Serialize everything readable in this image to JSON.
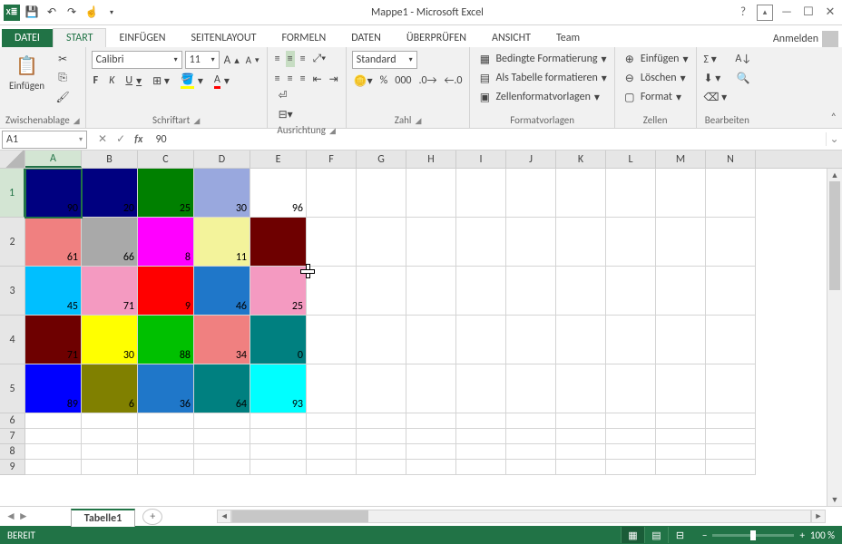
{
  "title": "Mappe1 - Microsoft Excel",
  "qat": [
    "XL",
    "💾",
    "↶",
    "↷",
    "↗"
  ],
  "tabs": {
    "file": "DATEI",
    "items": [
      "START",
      "EINFÜGEN",
      "SEITENLAYOUT",
      "FORMELN",
      "DATEN",
      "ÜBERPRÜFEN",
      "ANSICHT",
      "Team"
    ],
    "active": "START"
  },
  "signin": "Anmelden",
  "ribbon": {
    "clipboard": {
      "paste": "Einfügen",
      "label": "Zwischenablage"
    },
    "font": {
      "name": "Calibri",
      "size": "11",
      "label": "Schriftart",
      "bold": "F",
      "italic": "K",
      "underline": "U"
    },
    "align": {
      "label": "Ausrichtung"
    },
    "number": {
      "format": "Standard",
      "label": "Zahl"
    },
    "styles": {
      "cond": "Bedingte Formatierung",
      "table": "Als Tabelle formatieren",
      "cell": "Zellenformatvorlagen",
      "label": "Formatvorlagen"
    },
    "cells": {
      "insert": "Einfügen",
      "delete": "Löschen",
      "format": "Format",
      "label": "Zellen"
    },
    "editing": {
      "label": "Bearbeiten"
    }
  },
  "namebox": "A1",
  "formula": "90",
  "columns": [
    "A",
    "B",
    "C",
    "D",
    "E",
    "F",
    "G",
    "H",
    "I",
    "J",
    "K",
    "L",
    "M",
    "N"
  ],
  "colWidths": {
    "colored": 62,
    "rest": 55
  },
  "rowHeightsColored": 54,
  "rowHeightPlain": 17,
  "rows": [
    1,
    2,
    3,
    4,
    5,
    6,
    7,
    8,
    9
  ],
  "selected": {
    "cell": "A1",
    "col": "A",
    "row": 1
  },
  "cells": [
    [
      {
        "v": 90,
        "bg": "#000080"
      },
      {
        "v": 20,
        "bg": "#000080"
      },
      {
        "v": 25,
        "bg": "#008000"
      },
      {
        "v": 30,
        "bg": "#99a8de"
      },
      {
        "v": 96,
        "bg": "#ffffff"
      }
    ],
    [
      {
        "v": 61,
        "bg": "#f08080"
      },
      {
        "v": 66,
        "bg": "#a9a9a9"
      },
      {
        "v": 8,
        "bg": "#ff00ff"
      },
      {
        "v": 11,
        "bg": "#f3f39b"
      },
      {
        "v": "",
        "bg": "#6e0000"
      }
    ],
    [
      {
        "v": 45,
        "bg": "#00bfff"
      },
      {
        "v": 71,
        "bg": "#f49ac1"
      },
      {
        "v": 9,
        "bg": "#ff0000"
      },
      {
        "v": 46,
        "bg": "#1f77c9"
      },
      {
        "v": 25,
        "bg": "#f49ac1"
      }
    ],
    [
      {
        "v": 71,
        "bg": "#6e0000"
      },
      {
        "v": 30,
        "bg": "#ffff00"
      },
      {
        "v": 88,
        "bg": "#00c000"
      },
      {
        "v": 34,
        "bg": "#f08080"
      },
      {
        "v": 0,
        "bg": "#008080"
      }
    ],
    [
      {
        "v": 89,
        "bg": "#0000ff"
      },
      {
        "v": 6,
        "bg": "#808000"
      },
      {
        "v": 36,
        "bg": "#1f77c9"
      },
      {
        "v": 64,
        "bg": "#008080"
      },
      {
        "v": 93,
        "bg": "#00ffff"
      }
    ]
  ],
  "sheet": {
    "name": "Tabelle1"
  },
  "status": {
    "ready": "BEREIT",
    "zoom": "100 %"
  }
}
